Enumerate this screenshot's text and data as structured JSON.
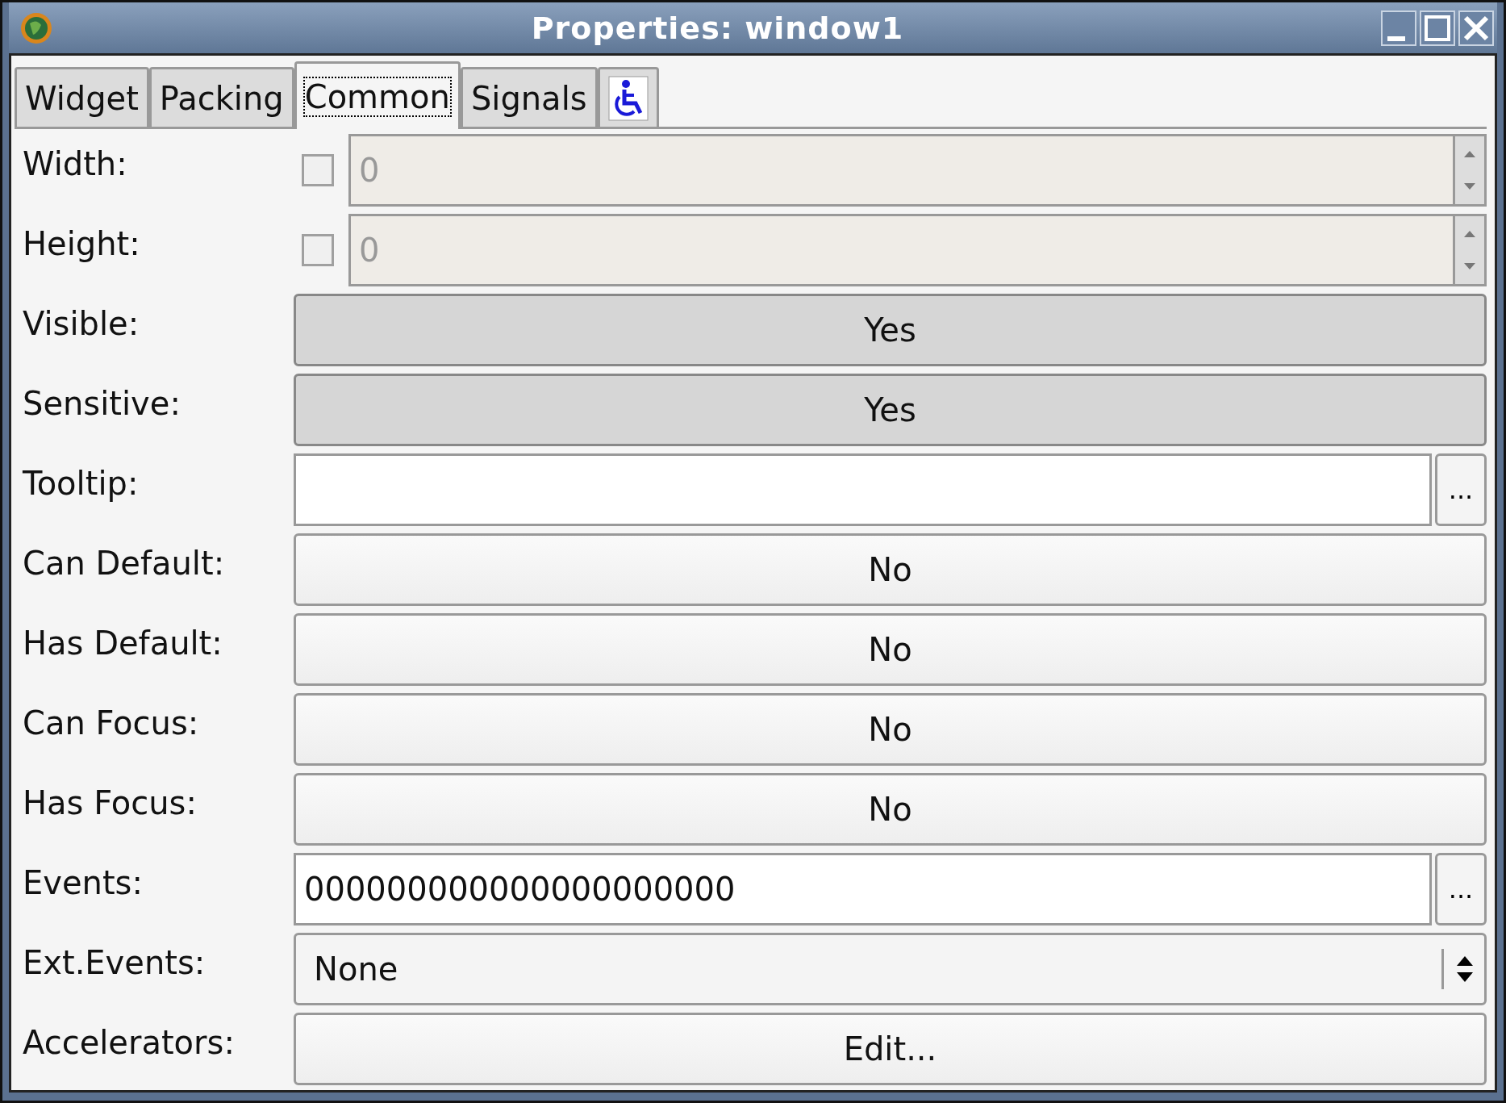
{
  "window": {
    "title": "Properties: window1"
  },
  "tabs": [
    {
      "kind": "text",
      "label": "Widget",
      "selected": false
    },
    {
      "kind": "text",
      "label": "Packing",
      "selected": false
    },
    {
      "kind": "text",
      "label": "Common",
      "selected": true
    },
    {
      "kind": "text",
      "label": "Signals",
      "selected": false
    },
    {
      "kind": "icon",
      "selected": false
    }
  ],
  "properties": [
    {
      "label": "Width:",
      "kind": "spin",
      "checked": false,
      "disabled": true,
      "value": "0"
    },
    {
      "label": "Height:",
      "kind": "spin",
      "checked": false,
      "disabled": true,
      "value": "0"
    },
    {
      "label": "Visible:",
      "kind": "toggle",
      "pressed": true,
      "value": "Yes"
    },
    {
      "label": "Sensitive:",
      "kind": "toggle",
      "pressed": true,
      "value": "Yes"
    },
    {
      "label": "Tooltip:",
      "kind": "text",
      "button": "..."
    },
    {
      "label": "Can Default:",
      "kind": "toggle",
      "pressed": false,
      "value": "No"
    },
    {
      "label": "Has Default:",
      "kind": "toggle",
      "pressed": false,
      "value": "No"
    },
    {
      "label": "Can Focus:",
      "kind": "toggle",
      "pressed": false,
      "value": "No"
    },
    {
      "label": "Has Focus:",
      "kind": "toggle",
      "pressed": false,
      "value": "No"
    },
    {
      "label": "Events:",
      "kind": "text",
      "value": "000000000000000000000",
      "button": "..."
    },
    {
      "label": "Ext.Events:",
      "kind": "combo",
      "value": "None"
    },
    {
      "label": "Accelerators:",
      "kind": "button",
      "value": "Edit..."
    }
  ]
}
